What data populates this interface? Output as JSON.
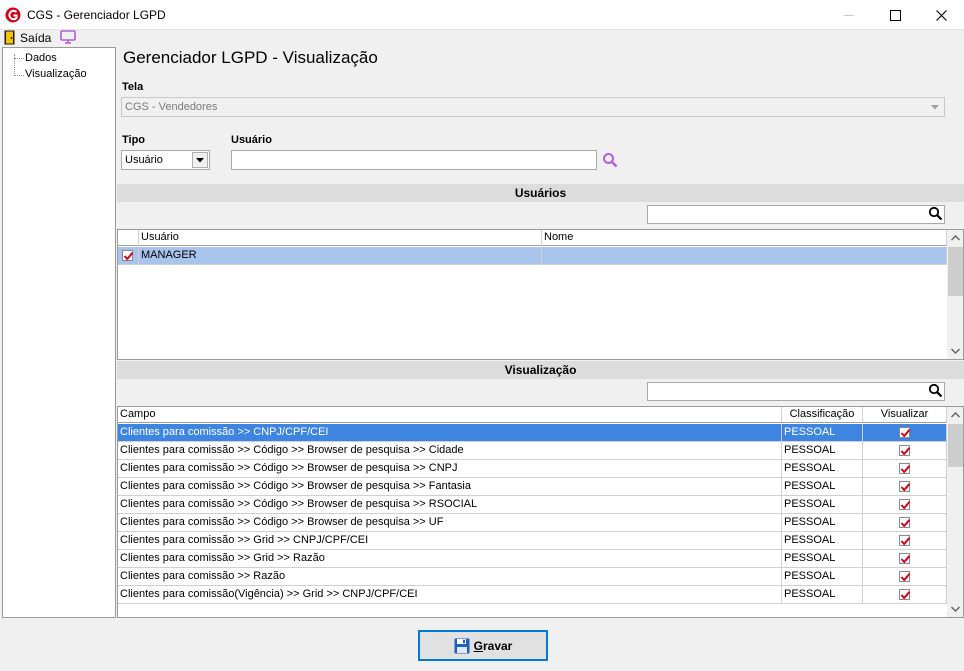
{
  "window": {
    "title": "CGS - Gerenciador LGPD",
    "min_glyph": "—",
    "close_glyph": "✕"
  },
  "menu": {
    "exit_label": "Saída"
  },
  "tree": {
    "items": [
      "Dados",
      "Visualização"
    ]
  },
  "page": {
    "title": "Gerenciador LGPD - Visualização"
  },
  "form": {
    "tela_label": "Tela",
    "tela_value": "CGS - Vendedores",
    "tipo_label": "Tipo",
    "tipo_value": "Usuário",
    "usuario_label": "Usuário",
    "usuario_value": ""
  },
  "users_section": {
    "header": "Usuários",
    "filter_value": "",
    "columns": [
      "Usuário",
      "Nome"
    ],
    "rows": [
      {
        "usuario": "MANAGER",
        "nome": "",
        "checked": true
      }
    ]
  },
  "view_section": {
    "header": "Visualização",
    "filter_value": "",
    "columns": [
      "Campo",
      "Classificação",
      "Visualizar"
    ],
    "rows": [
      {
        "campo": "Clientes para comissão >> CNPJ/CPF/CEI",
        "classificacao": "PESSOAL",
        "visualizar": true
      },
      {
        "campo": "Clientes para comissão >> Código >> Browser de pesquisa >> Cidade",
        "classificacao": "PESSOAL",
        "visualizar": true
      },
      {
        "campo": "Clientes para comissão >> Código >> Browser de pesquisa >> CNPJ",
        "classificacao": "PESSOAL",
        "visualizar": true
      },
      {
        "campo": "Clientes para comissão >> Código >> Browser de pesquisa >> Fantasia",
        "classificacao": "PESSOAL",
        "visualizar": true
      },
      {
        "campo": "Clientes para comissão >> Código >> Browser de pesquisa >> RSOCIAL",
        "classificacao": "PESSOAL",
        "visualizar": true
      },
      {
        "campo": "Clientes para comissão >> Código >> Browser de pesquisa >> UF",
        "classificacao": "PESSOAL",
        "visualizar": true
      },
      {
        "campo": "Clientes para comissão >> Grid >> CNPJ/CPF/CEI",
        "classificacao": "PESSOAL",
        "visualizar": true
      },
      {
        "campo": "Clientes para comissão >> Grid >> Razão",
        "classificacao": "PESSOAL",
        "visualizar": true
      },
      {
        "campo": "Clientes para comissão >> Razão",
        "classificacao": "PESSOAL",
        "visualizar": true
      },
      {
        "campo": "Clientes para comissão(Vigência) >> Grid >> CNPJ/CPF/CEI",
        "classificacao": "PESSOAL",
        "visualizar": true
      }
    ]
  },
  "footer": {
    "save_mnemonic": "G",
    "save_rest": "ravar"
  },
  "colors": {
    "selection": "#3d85e0",
    "user_selection": "#a9c4ec",
    "checkmark": "#d0021b",
    "accent_icon": "#b05fd6"
  }
}
